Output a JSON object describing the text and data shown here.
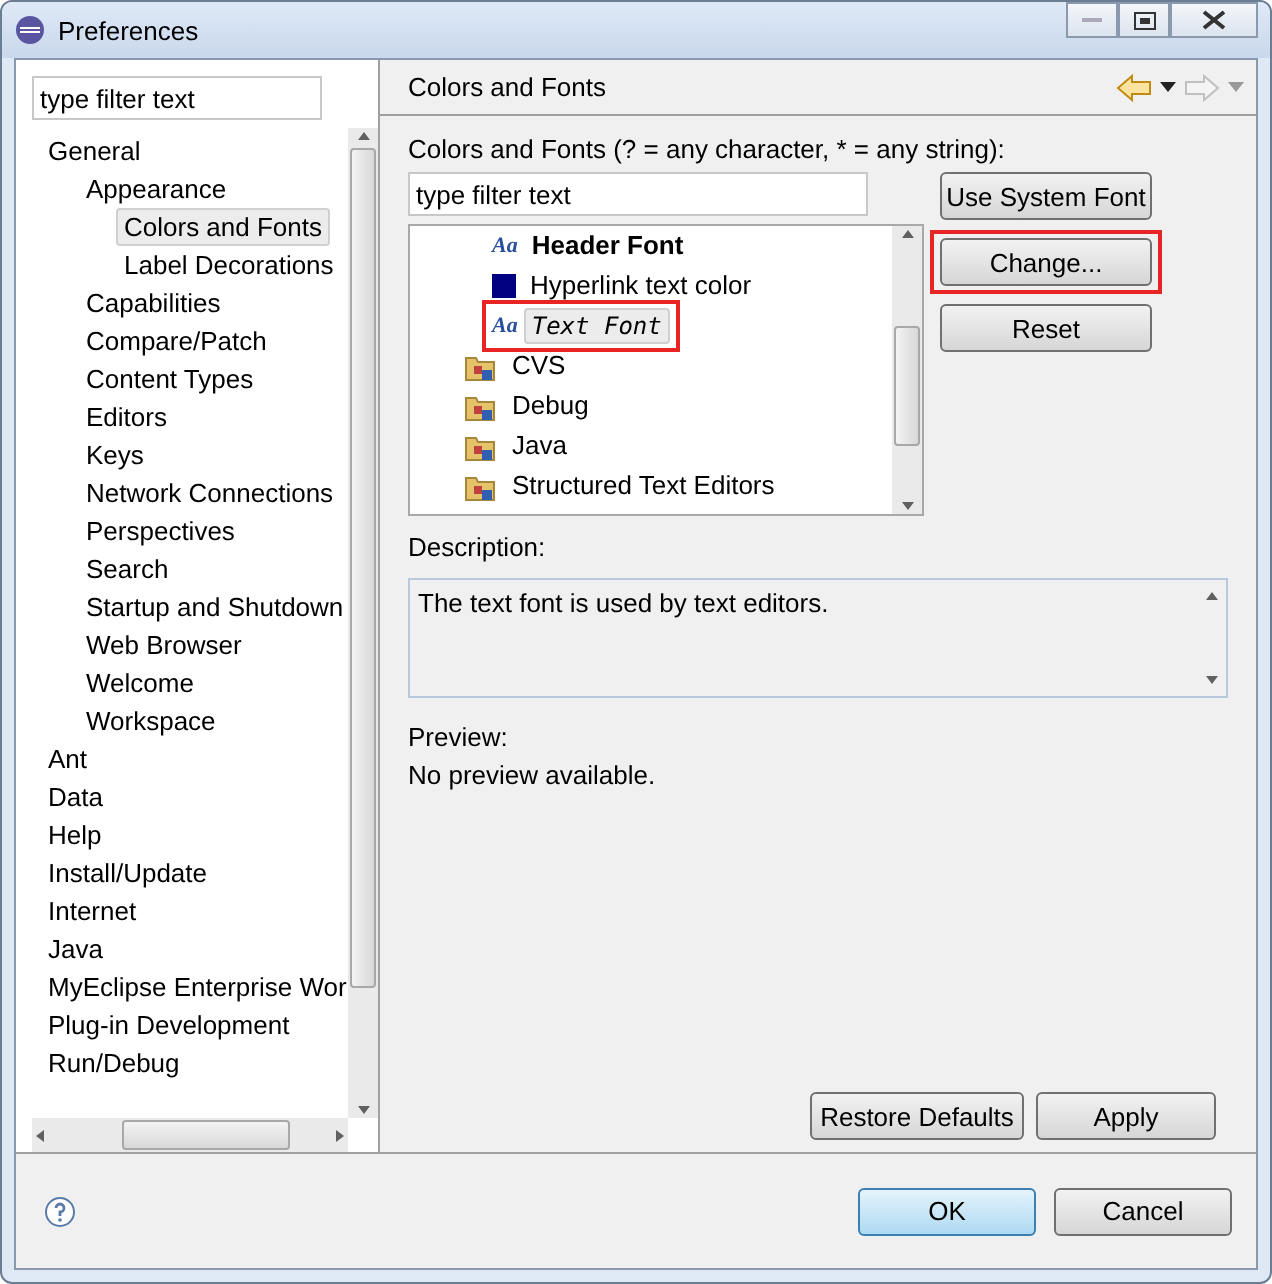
{
  "window": {
    "title": "Preferences"
  },
  "sidebar": {
    "filter": {
      "placeholder": "type filter text"
    },
    "items": [
      {
        "label": "General",
        "selected": false,
        "children": [
          {
            "label": "Appearance",
            "selected": false,
            "children": [
              {
                "label": "Colors and Fonts",
                "selected": true
              },
              {
                "label": "Label Decorations",
                "selected": false
              }
            ]
          },
          {
            "label": "Capabilities",
            "selected": false
          },
          {
            "label": "Compare/Patch",
            "selected": false
          },
          {
            "label": "Content Types",
            "selected": false
          },
          {
            "label": "Editors",
            "selected": false
          },
          {
            "label": "Keys",
            "selected": false
          },
          {
            "label": "Network Connections",
            "selected": false
          },
          {
            "label": "Perspectives",
            "selected": false
          },
          {
            "label": "Search",
            "selected": false
          },
          {
            "label": "Startup and Shutdown",
            "selected": false
          },
          {
            "label": "Web Browser",
            "selected": false
          },
          {
            "label": "Welcome",
            "selected": false
          },
          {
            "label": "Workspace",
            "selected": false
          }
        ]
      },
      {
        "label": "Ant",
        "selected": false
      },
      {
        "label": "Data",
        "selected": false
      },
      {
        "label": "Help",
        "selected": false
      },
      {
        "label": "Install/Update",
        "selected": false
      },
      {
        "label": "Internet",
        "selected": false
      },
      {
        "label": "Java",
        "selected": false
      },
      {
        "label": "MyEclipse Enterprise Wor",
        "selected": false
      },
      {
        "label": "Plug-in Development",
        "selected": false
      },
      {
        "label": "Run/Debug",
        "selected": false
      }
    ]
  },
  "page": {
    "title": "Colors and Fonts",
    "filter_label": "Colors and Fonts (? = any character, * = any string):",
    "filter": {
      "placeholder": "type filter text"
    },
    "tree": [
      {
        "kind": "font",
        "icon": "Aa",
        "label": "Header Font",
        "selected": false,
        "highlighted": false
      },
      {
        "kind": "color",
        "label": "Hyperlink text color",
        "selected": false,
        "highlighted": false,
        "color": "#000080"
      },
      {
        "kind": "font",
        "icon": "Aa",
        "label": "Text Font",
        "selected": true,
        "highlighted": true
      },
      {
        "kind": "category",
        "label": "CVS",
        "selected": false,
        "highlighted": false
      },
      {
        "kind": "category",
        "label": "Debug",
        "selected": false,
        "highlighted": false
      },
      {
        "kind": "category",
        "label": "Java",
        "selected": false,
        "highlighted": false
      },
      {
        "kind": "category",
        "label": "Structured Text Editors",
        "selected": false,
        "highlighted": false
      }
    ],
    "side_buttons": [
      {
        "label": "Use System Font",
        "highlighted": false
      },
      {
        "label": "Change...",
        "highlighted": true
      },
      {
        "label": "Reset",
        "highlighted": false
      }
    ],
    "description_label": "Description:",
    "description": "The text font is used by text editors.",
    "preview_label": "Preview:",
    "preview": "No preview available.",
    "buttons": [
      "Restore Defaults",
      "Apply"
    ]
  },
  "footer": {
    "buttons": [
      {
        "label": "OK",
        "default": true
      },
      {
        "label": "Cancel",
        "default": false
      }
    ]
  }
}
